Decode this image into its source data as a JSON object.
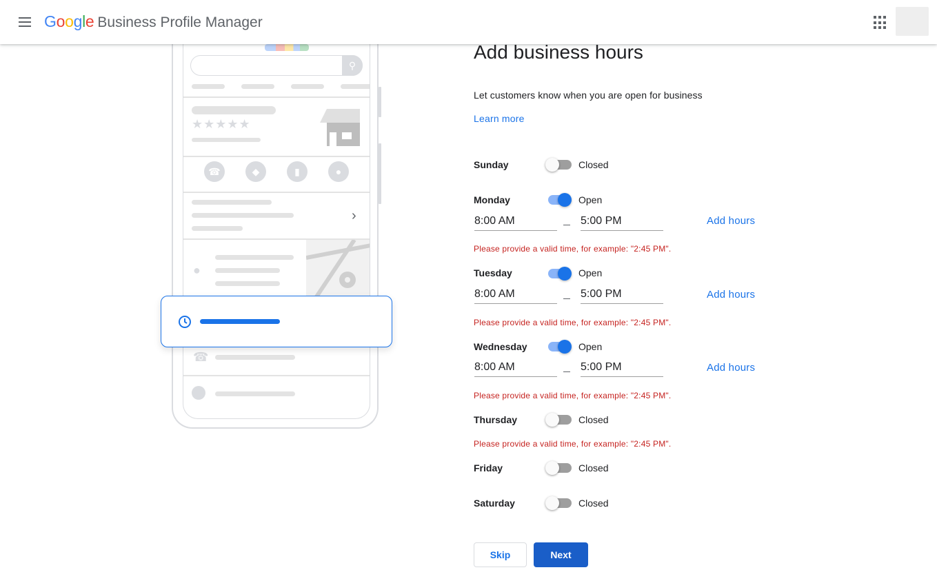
{
  "header": {
    "logo_letters": [
      "G",
      "o",
      "o",
      "g",
      "l",
      "e"
    ],
    "logo_colors": [
      "#4285f4",
      "#ea4335",
      "#fbbc05",
      "#4285f4",
      "#34a853",
      "#ea4335"
    ],
    "product_name": "Business Profile Manager",
    "menu_icon": "hamburger-menu-icon",
    "apps_icon": "apps-grid-icon"
  },
  "page": {
    "title": "Add business hours",
    "subtitle": "Let customers know when you are open for business",
    "learn_more": "Learn more"
  },
  "days": [
    {
      "name": "Sunday",
      "open": false,
      "status": "Closed"
    },
    {
      "name": "Monday",
      "open": true,
      "status": "Open",
      "open_time": "8:00 AM",
      "close_time": "5:00 PM",
      "add_hours": "Add hours",
      "error": "Please provide a valid time, for example: \"2:45 PM\"."
    },
    {
      "name": "Tuesday",
      "open": true,
      "status": "Open",
      "open_time": "8:00 AM",
      "close_time": "5:00 PM",
      "add_hours": "Add hours",
      "error": "Please provide a valid time, for example: \"2:45 PM\"."
    },
    {
      "name": "Wednesday",
      "open": true,
      "status": "Open",
      "open_time": "8:00 AM",
      "close_time": "5:00 PM",
      "add_hours": "Add hours",
      "error": "Please provide a valid time, for example: \"2:45 PM\"."
    },
    {
      "name": "Thursday",
      "open": false,
      "status": "Closed",
      "error": "Please provide a valid time, for example: \"2:45 PM\"."
    },
    {
      "name": "Friday",
      "open": false,
      "status": "Closed"
    },
    {
      "name": "Saturday",
      "open": false,
      "status": "Closed"
    }
  ],
  "actions": {
    "skip": "Skip",
    "next": "Next"
  },
  "colors": {
    "accent": "#1a73e8",
    "primary_button": "#1a5ec8",
    "error": "#c5221f"
  }
}
